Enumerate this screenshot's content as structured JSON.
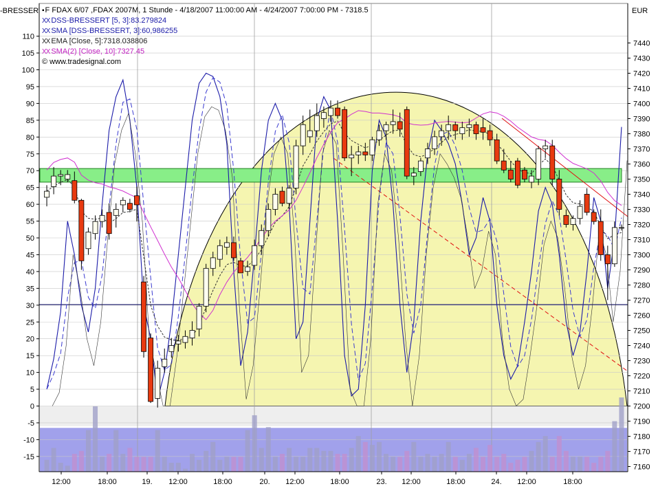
{
  "window": {
    "left_label": "-BRESSERT",
    "right_label": "EUR"
  },
  "legend": {
    "title": "F FDAX 6/07 ,FDAX 2007M, 1 Stunde - 4/18/2007 11:00:00 AM - 4/24/2007 7:00:00 PM - 7318.5",
    "dss": "DSS-BRESSERT [5, 3]:83.279824",
    "sma3": "SMA [DSS-BRESSERT, 3]:60,986255",
    "ema": "EMA [Close, 5]:7318.038806",
    "sma10": "SMA(2) [Close, 10]:7327.45",
    "source": "© www.tradesignal.com",
    "marker": "XX"
  },
  "colors": {
    "dss": "#1a1aa8",
    "sma3": "#3a3ad0",
    "ema": "#333333",
    "sma10": "#d030d0",
    "bull": "#fffff0",
    "bear": "#e83a10",
    "arc_fill": "#f5f5b0",
    "zone_fill": "#88ee88",
    "lower_band": "#9090e8",
    "trend_red": "#e01010"
  },
  "chart_data": {
    "type": "candlestick",
    "x_labels": [
      "12:00",
      "18:00",
      "19.",
      "12:00",
      "18:00",
      "20.",
      "12:00",
      "18:00",
      "23.",
      "12:00",
      "18:00",
      "24.",
      "12:00",
      "18:00"
    ],
    "left_axis": {
      "ticks": [
        110,
        105,
        100,
        95,
        90,
        85,
        80,
        75,
        70,
        65,
        60,
        55,
        50,
        45,
        40,
        35,
        30,
        25,
        20,
        15,
        10,
        5,
        0,
        -5,
        -10,
        -15
      ],
      "range": [
        -19,
        117
      ]
    },
    "right_axis": {
      "ticks": [
        7440,
        7430,
        7420,
        7410,
        7400,
        7390,
        7380,
        7370,
        7360,
        7350,
        7340,
        7330,
        7320,
        7310,
        7300,
        7290,
        7280,
        7270,
        7260,
        7250,
        7240,
        7230,
        7220,
        7210,
        7200,
        7190,
        7180,
        7170,
        7160
      ],
      "range": [
        7155,
        7447
      ]
    },
    "candles": [
      [
        7338,
        7346,
        7332,
        7342
      ],
      [
        7345,
        7358,
        7340,
        7352
      ],
      [
        7352,
        7356,
        7346,
        7353
      ],
      [
        7350,
        7356,
        7348,
        7353
      ],
      [
        7349,
        7355,
        7334,
        7336
      ],
      [
        7336,
        7337,
        7290,
        7296
      ],
      [
        7304,
        7318,
        7300,
        7315
      ],
      [
        7314,
        7326,
        7310,
        7322
      ],
      [
        7322,
        7330,
        7318,
        7326
      ],
      [
        7328,
        7334,
        7310,
        7314
      ],
      [
        7326,
        7334,
        7318,
        7330
      ],
      [
        7333,
        7338,
        7328,
        7336
      ],
      [
        7334,
        7337,
        7328,
        7330
      ],
      [
        7339,
        7345,
        7322,
        7333
      ],
      [
        7282,
        7286,
        7232,
        7236
      ],
      [
        7245,
        7248,
        7202,
        7203
      ],
      [
        7205,
        7230,
        7199,
        7225
      ],
      [
        7226,
        7238,
        7222,
        7231
      ],
      [
        7236,
        7245,
        7232,
        7240
      ],
      [
        7241,
        7247,
        7236,
        7243
      ],
      [
        7242,
        7250,
        7238,
        7246
      ],
      [
        7245,
        7256,
        7240,
        7250
      ],
      [
        7251,
        7268,
        7246,
        7266
      ],
      [
        7266,
        7294,
        7262,
        7291
      ],
      [
        7291,
        7302,
        7286,
        7298
      ],
      [
        7297,
        7310,
        7292,
        7306
      ],
      [
        7305,
        7312,
        7300,
        7308
      ],
      [
        7308,
        7312,
        7296,
        7298
      ],
      [
        7296,
        7298,
        7288,
        7288
      ],
      [
        7289,
        7296,
        7286,
        7292
      ],
      [
        7293,
        7310,
        7290,
        7306
      ],
      [
        7306,
        7320,
        7300,
        7316
      ],
      [
        7316,
        7334,
        7312,
        7330
      ],
      [
        7330,
        7344,
        7326,
        7340
      ],
      [
        7342,
        7345,
        7332,
        7334
      ],
      [
        7334,
        7346,
        7330,
        7344
      ],
      [
        7344,
        7376,
        7340,
        7372
      ],
      [
        7372,
        7392,
        7366,
        7386
      ],
      [
        7378,
        7396,
        7374,
        7382
      ],
      [
        7382,
        7400,
        7378,
        7392
      ],
      [
        7390,
        7398,
        7384,
        7394
      ],
      [
        7392,
        7402,
        7388,
        7397
      ],
      [
        7397,
        7402,
        7390,
        7392
      ],
      [
        7396,
        7398,
        7362,
        7364
      ],
      [
        7364,
        7372,
        7352,
        7366
      ],
      [
        7366,
        7372,
        7360,
        7368
      ],
      [
        7368,
        7374,
        7362,
        7366
      ],
      [
        7366,
        7378,
        7362,
        7376
      ],
      [
        7376,
        7386,
        7372,
        7382
      ],
      [
        7382,
        7388,
        7376,
        7386
      ],
      [
        7386,
        7396,
        7380,
        7388
      ],
      [
        7388,
        7394,
        7378,
        7383
      ],
      [
        7396,
        7398,
        7350,
        7352
      ],
      [
        7352,
        7358,
        7346,
        7354
      ],
      [
        7355,
        7364,
        7352,
        7362
      ],
      [
        7364,
        7374,
        7360,
        7370
      ],
      [
        7370,
        7382,
        7366,
        7378
      ],
      [
        7378,
        7386,
        7372,
        7382
      ],
      [
        7382,
        7392,
        7376,
        7386
      ],
      [
        7386,
        7388,
        7376,
        7382
      ],
      [
        7380,
        7388,
        7376,
        7384
      ],
      [
        7384,
        7390,
        7378,
        7386
      ],
      [
        7386,
        7388,
        7376,
        7380
      ],
      [
        7384,
        7390,
        7376,
        7381
      ],
      [
        7382,
        7386,
        7372,
        7376
      ],
      [
        7376,
        7380,
        7360,
        7362
      ],
      [
        7362,
        7370,
        7354,
        7356
      ],
      [
        7356,
        7362,
        7348,
        7350
      ],
      [
        7362,
        7364,
        7344,
        7346
      ],
      [
        7356,
        7358,
        7348,
        7350
      ],
      [
        7348,
        7356,
        7344,
        7352
      ],
      [
        7350,
        7372,
        7346,
        7370
      ],
      [
        7370,
        7376,
        7364,
        7372
      ],
      [
        7372,
        7376,
        7346,
        7350
      ],
      [
        7350,
        7356,
        7326,
        7330
      ],
      [
        7326,
        7330,
        7318,
        7320
      ],
      [
        7320,
        7326,
        7316,
        7324
      ],
      [
        7324,
        7336,
        7320,
        7332
      ],
      [
        7340,
        7344,
        7326,
        7328
      ],
      [
        7328,
        7330,
        7320,
        7322
      ],
      [
        7322,
        7330,
        7296,
        7300
      ],
      [
        7300,
        7306,
        7270,
        7294
      ],
      [
        7294,
        7322,
        7292,
        7318
      ],
      [
        7318,
        7320,
        7316,
        7318
      ]
    ],
    "volume": [
      4,
      8,
      3,
      2,
      6,
      7,
      14,
      22,
      5,
      6,
      14,
      6,
      8,
      5,
      5,
      5,
      14,
      5,
      3,
      3,
      1,
      6,
      4,
      7,
      10,
      4,
      5,
      5,
      5,
      14,
      19,
      8,
      15,
      5,
      6,
      8,
      5,
      5,
      8,
      8,
      7,
      7,
      6,
      6,
      8,
      12,
      10,
      9,
      10,
      6,
      5,
      5,
      7,
      10,
      5,
      6,
      5,
      6,
      10,
      5,
      4,
      6,
      8,
      5,
      9,
      5,
      6,
      3,
      4,
      5,
      7,
      10,
      12,
      5,
      12,
      7,
      5,
      5,
      5,
      3,
      5,
      7,
      17,
      25
    ],
    "dss": [
      5,
      14,
      28,
      55,
      45,
      30,
      22,
      35,
      60,
      82,
      92,
      97,
      85,
      65,
      30,
      20,
      2,
      10,
      25,
      45,
      65,
      85,
      96,
      99,
      98,
      92,
      78,
      40,
      12,
      22,
      45,
      70,
      85,
      90,
      85,
      60,
      20,
      25,
      55,
      85,
      92,
      88,
      55,
      15,
      3,
      5,
      30,
      70,
      85,
      80,
      60,
      30,
      10,
      25,
      55,
      75,
      85,
      82,
      78,
      72,
      60,
      45,
      50,
      62,
      55,
      30,
      15,
      8,
      12,
      25,
      40,
      58,
      65,
      60,
      45,
      25,
      15,
      22,
      40,
      62,
      55,
      35,
      50,
      83
    ]
  }
}
